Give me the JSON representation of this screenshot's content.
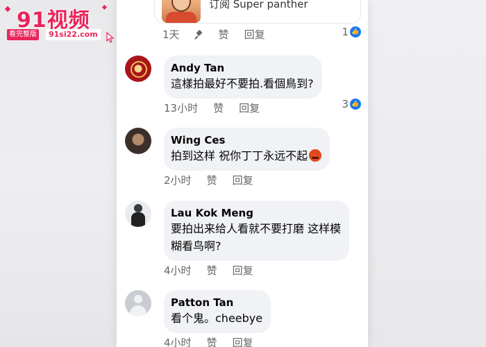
{
  "watermark": {
    "title": "91视频",
    "badge": "看完整版",
    "url": "91si22.com"
  },
  "top_post": {
    "text": "订阅 Super panther",
    "meta": {
      "time": "1天",
      "like": "赞",
      "reply": "回复"
    },
    "reactions": "1"
  },
  "comments": [
    {
      "name": "Andy Tan",
      "text_lines": [
        "這樣拍最好不要拍.看個鳥到?"
      ],
      "time": "13小时",
      "like": "赞",
      "reply": "回复",
      "reactions": "3"
    },
    {
      "name": "Wing Ces",
      "text_lines": [
        "拍到这样 祝你丁丁永远不起"
      ],
      "time": "2小时",
      "like": "赞",
      "reply": "回复"
    },
    {
      "name": "Lau Kok Meng",
      "text_lines": [
        "要拍出来给人看就不要打磨 这样模",
        "糊看鸟啊?"
      ],
      "time": "4小时",
      "like": "赞",
      "reply": "回复"
    },
    {
      "name": "Patton Tan",
      "text_lines": [
        "看个鬼。cheebye"
      ],
      "time": "4小时",
      "like": "赞",
      "reply": "回复"
    }
  ],
  "colors": {
    "like_blue": "#1877f2",
    "bubble": "#f0f2f5",
    "meta_gray": "#65676b",
    "watermark_pink": "#e8255a"
  },
  "icons": [
    "pin-icon",
    "like-badge-icon",
    "default-avatar-icon",
    "angry-emoji-icon"
  ]
}
